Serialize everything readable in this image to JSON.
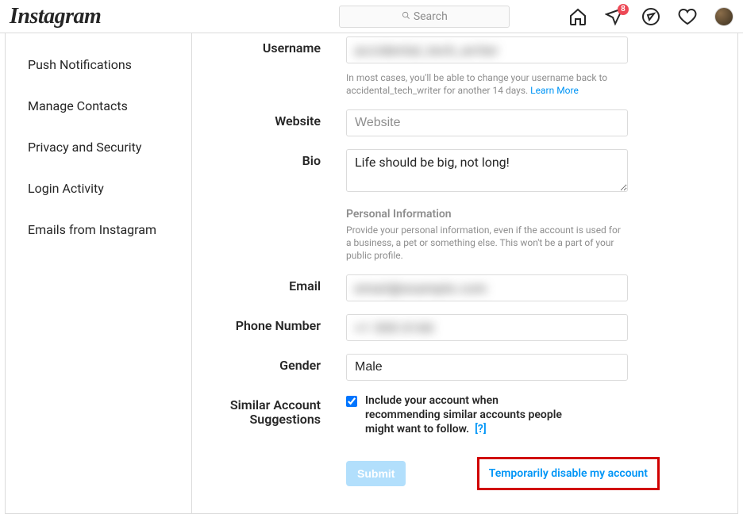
{
  "brand": "Instagram",
  "search_placeholder": "Search",
  "notif_count": "8",
  "sidebar": {
    "items": [
      {
        "label": "Push Notifications"
      },
      {
        "label": "Manage Contacts"
      },
      {
        "label": "Privacy and Security"
      },
      {
        "label": "Login Activity"
      },
      {
        "label": "Emails from Instagram"
      }
    ]
  },
  "form": {
    "username": {
      "label": "Username",
      "value": ""
    },
    "username_help": "In most cases, you'll be able to change your username back to accidental_tech_writer for another 14 days. ",
    "learn_more": "Learn More",
    "website": {
      "label": "Website",
      "placeholder": "Website",
      "value": ""
    },
    "bio": {
      "label": "Bio",
      "value": "Life should be big, not long!"
    },
    "personal_info_title": "Personal Information",
    "personal_info_desc": "Provide your personal information, even if the account is used for a business, a pet or something else. This won't be a part of your public profile.",
    "email": {
      "label": "Email",
      "value": ""
    },
    "phone": {
      "label": "Phone Number",
      "value": ""
    },
    "gender": {
      "label": "Gender",
      "value": "Male"
    },
    "similar": {
      "label": "Similar Account Suggestions",
      "checkbox_label": "Include your account when recommending similar accounts people might want to follow.",
      "help_link": "[?]"
    },
    "submit_label": "Submit",
    "disable_label": "Temporarily disable my account"
  }
}
